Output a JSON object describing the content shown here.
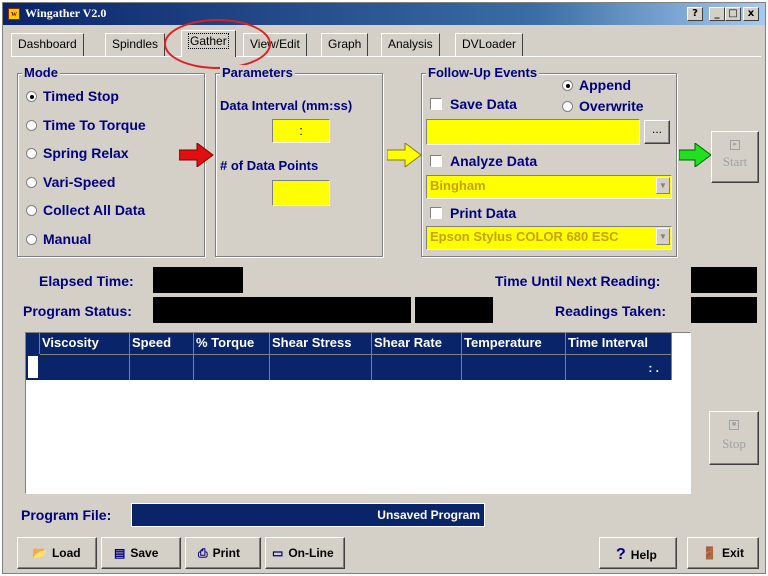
{
  "window": {
    "title": "Wingather V2.0",
    "help_btn": "?",
    "min_btn": "_",
    "max_btn": "□",
    "close_btn": "x"
  },
  "tabs": [
    {
      "label": "Dashboard"
    },
    {
      "label": "Spindles"
    },
    {
      "label": "Gather"
    },
    {
      "label": "View/Edit"
    },
    {
      "label": "Graph"
    },
    {
      "label": "Analysis"
    },
    {
      "label": "DVLoader"
    }
  ],
  "mode": {
    "title": "Mode",
    "options": [
      {
        "label": "Timed Stop",
        "selected": true
      },
      {
        "label": "Time To Torque",
        "selected": false
      },
      {
        "label": "Spring Relax",
        "selected": false
      },
      {
        "label": "Vari-Speed",
        "selected": false
      },
      {
        "label": "Collect All Data",
        "selected": false
      },
      {
        "label": "Manual",
        "selected": false
      }
    ]
  },
  "parameters": {
    "title": "Parameters",
    "interval_label": "Data Interval (mm:ss)",
    "interval_value": ":",
    "points_label": "# of Data Points",
    "points_value": ""
  },
  "followup": {
    "title": "Follow-Up Events",
    "append_label": "Append",
    "overwrite_label": "Overwrite",
    "save_data_label": "Save Data",
    "save_path": "",
    "browse_label": "...",
    "analyze_label": "Analyze Data",
    "analyze_model": "Bingham",
    "print_label": "Print Data",
    "printer": "Epson Stylus COLOR 680 ESC"
  },
  "start_label": "Start",
  "stop_label": "Stop",
  "status": {
    "elapsed_label": "Elapsed Time:",
    "next_reading_label": "Time Until Next Reading:",
    "program_status_label": "Program Status:",
    "readings_taken_label": "Readings Taken:"
  },
  "table": {
    "columns": [
      "Viscosity",
      "Speed",
      "% Torque",
      "Shear Stress",
      "Shear Rate",
      "Temperature",
      "Time Interval"
    ],
    "rows": [
      [
        "",
        "",
        "",
        "",
        "",
        "",
        ":  ."
      ]
    ]
  },
  "program_file": {
    "label": "Program File:",
    "value": "Unsaved Program"
  },
  "buttons": {
    "load": "Load",
    "save": "Save",
    "print": "Print",
    "online": "On-Line",
    "help": "Help",
    "exit": "Exit"
  },
  "colors": {
    "field_yellow": "#ffff00",
    "title_navy": "#0a246a",
    "label_navy": "#000080"
  }
}
